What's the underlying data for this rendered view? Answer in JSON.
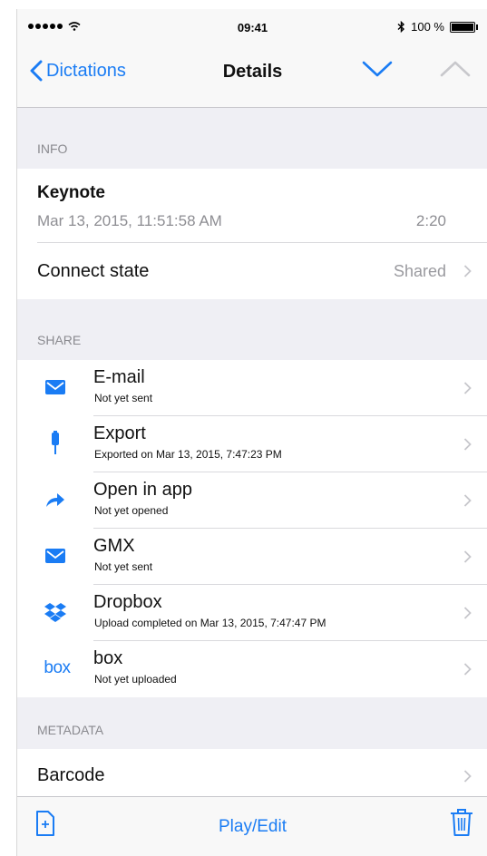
{
  "status": {
    "time": "09:41",
    "battery": "100 %"
  },
  "nav": {
    "back_label": "Dictations",
    "title": "Details"
  },
  "info": {
    "header": "INFO",
    "title": "Keynote",
    "date": "Mar 13, 2015, 11:51:58 AM",
    "duration": "2:20",
    "connect_label": "Connect state",
    "connect_value": "Shared"
  },
  "share": {
    "header": "SHARE",
    "items": [
      {
        "name": "E-mail",
        "sub": "Not yet sent",
        "icon": "mail-icon"
      },
      {
        "name": "Export",
        "sub": "Exported on Mar 13, 2015, 7:47:23 PM",
        "icon": "usb-export-icon"
      },
      {
        "name": "Open in app",
        "sub": "Not yet opened",
        "icon": "share-arrow-icon"
      },
      {
        "name": "GMX",
        "sub": "Not yet sent",
        "icon": "mail-icon"
      },
      {
        "name": "Dropbox",
        "sub": "Upload completed on Mar 13, 2015, 7:47:47 PM",
        "icon": "dropbox-icon"
      },
      {
        "name": "box",
        "sub": "Not yet uploaded",
        "icon": "box-icon",
        "icon_text": "box"
      }
    ]
  },
  "metadata": {
    "header": "METADATA",
    "barcode_label": "Barcode"
  },
  "toolbar": {
    "center_label": "Play/Edit"
  },
  "colors": {
    "accent": "#1a7cf4",
    "background": "#efeff4",
    "secondary_text": "#8e8e93"
  }
}
